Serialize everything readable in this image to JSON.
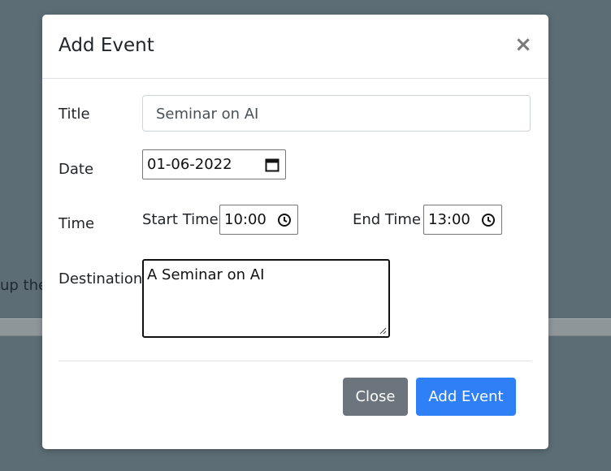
{
  "background": {
    "partial_text": "up the"
  },
  "modal": {
    "title": "Add Event",
    "close_symbol": "×",
    "fields": {
      "title_label": "Title",
      "title_value": "Seminar on AI",
      "date_label": "Date",
      "date_value": "01-06-2022",
      "time_label": "Time",
      "start_time_label": "Start Time",
      "start_time_value": "10:00",
      "end_time_label": "End Time",
      "end_time_value": "13:00",
      "destination_label": "Destination",
      "destination_value": "A Seminar on AI"
    },
    "buttons": {
      "close": "Close",
      "add": "Add Event"
    }
  },
  "colors": {
    "backdrop": "#5d6d75",
    "close_button": "#6c757d",
    "add_button": "#2f80f7"
  },
  "icons": {
    "date": "calendar-icon",
    "time": "clock-icon",
    "resize": "resize-grip-icon"
  }
}
